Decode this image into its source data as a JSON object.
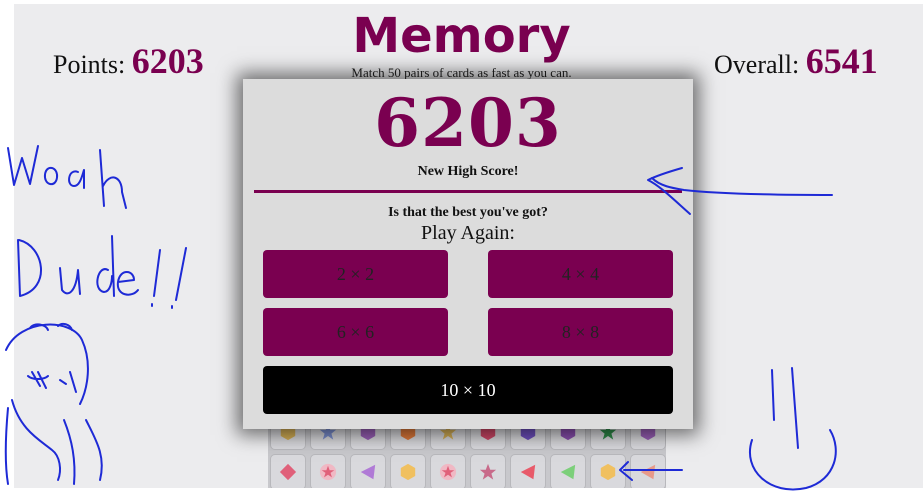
{
  "header": {
    "points_label": "Points:",
    "points_value": "6203",
    "title": "Memory",
    "subtitle": "Match 50 pairs of cards as fast as you can.",
    "overall_label": "Overall:",
    "overall_value": "6541"
  },
  "modal": {
    "score": "6203",
    "high_score_text": "New High Score!",
    "tagline": "Is that the best you've got?",
    "play_again_label": "Play Again:",
    "buttons": [
      "2 × 2",
      "4 × 4",
      "6 × 6",
      "8 × 8",
      "10 × 10"
    ]
  },
  "board": {
    "visible_shapes": [
      "diamond-icon",
      "star-icon",
      "triangle-icon",
      "hexagon-icon",
      "star-icon",
      "star-icon",
      "triangle-icon",
      "triangle-icon",
      "hexagon-icon",
      "triangle-icon"
    ]
  },
  "colors": {
    "accent": "#7a0050",
    "modal_bg": "#dcdcdc",
    "primary_button": "#000000",
    "annotation_ink": "#1e2ad6"
  }
}
